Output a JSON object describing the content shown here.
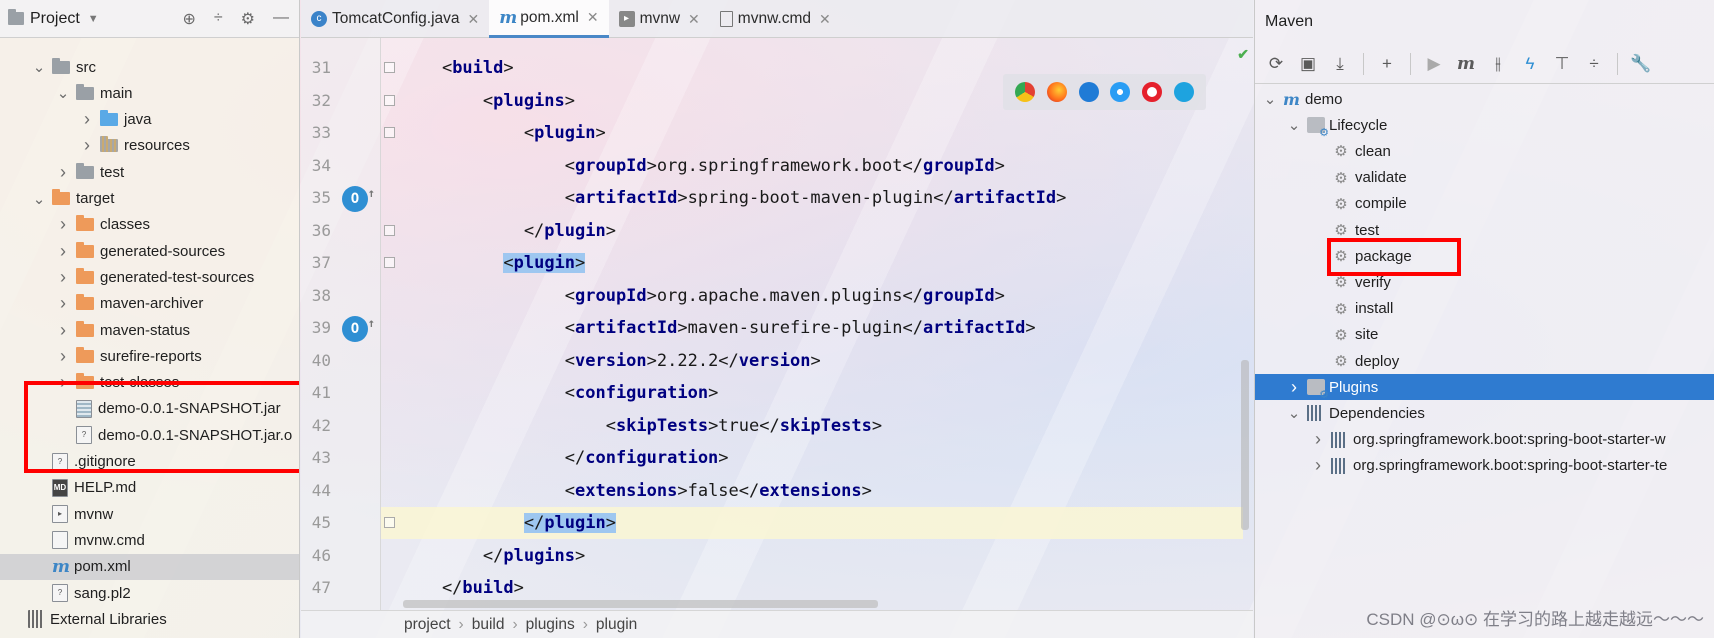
{
  "project": {
    "title": "Project",
    "tree": [
      {
        "label": "src",
        "icon": "folder",
        "expanded": true
      },
      {
        "label": "main",
        "icon": "folder",
        "expanded": true
      },
      {
        "label": "java",
        "icon": "source-folder",
        "expanded": false
      },
      {
        "label": "resources",
        "icon": "resources-folder",
        "expanded": false
      },
      {
        "label": "test",
        "icon": "folder",
        "expanded": false
      },
      {
        "label": "target",
        "icon": "excluded-folder",
        "expanded": true
      },
      {
        "label": "classes",
        "icon": "excluded-folder",
        "expanded": false
      },
      {
        "label": "generated-sources",
        "icon": "excluded-folder",
        "expanded": false
      },
      {
        "label": "generated-test-sources",
        "icon": "excluded-folder",
        "expanded": false
      },
      {
        "label": "maven-archiver",
        "icon": "excluded-folder",
        "expanded": false
      },
      {
        "label": "maven-status",
        "icon": "excluded-folder",
        "expanded": false
      },
      {
        "label": "surefire-reports",
        "icon": "excluded-folder",
        "expanded": false
      },
      {
        "label": "test-classes",
        "icon": "excluded-folder",
        "expanded": false
      },
      {
        "label": "demo-0.0.1-SNAPSHOT.jar",
        "icon": "jar-file"
      },
      {
        "label": "demo-0.0.1-SNAPSHOT.jar.o",
        "icon": "unknown-file"
      },
      {
        "label": ".gitignore",
        "icon": "unknown-file"
      },
      {
        "label": "HELP.md",
        "icon": "markdown-file"
      },
      {
        "label": "mvnw",
        "icon": "script-file"
      },
      {
        "label": "mvnw.cmd",
        "icon": "text-file"
      },
      {
        "label": "pom.xml",
        "icon": "maven-file",
        "selected": true
      },
      {
        "label": "sang.pl2",
        "icon": "unknown-file"
      },
      {
        "label": "External Libraries",
        "icon": "libraries"
      }
    ]
  },
  "editor": {
    "tabs": [
      {
        "label": "TomcatConfig.java",
        "icon": "class-icon",
        "active": false
      },
      {
        "label": "pom.xml",
        "icon": "maven-icon",
        "active": true
      },
      {
        "label": "mvnw",
        "icon": "script-icon",
        "active": false
      },
      {
        "label": "mvnw.cmd",
        "icon": "text-icon",
        "active": false
      }
    ],
    "lines": [
      {
        "n": "31",
        "text": "    <build>"
      },
      {
        "n": "32",
        "text": "        <plugins>"
      },
      {
        "n": "33",
        "text": "            <plugin>"
      },
      {
        "n": "34",
        "text": "                <groupId>org.springframework.boot</groupId>"
      },
      {
        "n": "35",
        "text": "                <artifactId>spring-boot-maven-plugin</artifactId>"
      },
      {
        "n": "36",
        "text": "            </plugin>"
      },
      {
        "n": "37",
        "text": "          <plugin>"
      },
      {
        "n": "38",
        "text": "                <groupId>org.apache.maven.plugins</groupId>"
      },
      {
        "n": "39",
        "text": "                <artifactId>maven-surefire-plugin</artifactId>"
      },
      {
        "n": "40",
        "text": "                <version>2.22.2</version>"
      },
      {
        "n": "41",
        "text": "                <configuration>"
      },
      {
        "n": "42",
        "text": "                    <skipTests>true</skipTests>"
      },
      {
        "n": "43",
        "text": "                </configuration>"
      },
      {
        "n": "44",
        "text": "                <extensions>false</extensions>"
      },
      {
        "n": "45",
        "text": "            </plugin>"
      },
      {
        "n": "46",
        "text": "        </plugins>"
      },
      {
        "n": "47",
        "text": "    </build>"
      }
    ],
    "breadcrumb": [
      "project",
      "build",
      "plugins",
      "plugin"
    ]
  },
  "maven": {
    "title": "Maven",
    "project": "demo",
    "lifecycle_label": "Lifecycle",
    "lifecycle": [
      "clean",
      "validate",
      "compile",
      "test",
      "package",
      "verify",
      "install",
      "site",
      "deploy"
    ],
    "plugins_label": "Plugins",
    "dependencies_label": "Dependencies",
    "dependencies": [
      "org.springframework.boot:spring-boot-starter-w",
      "org.springframework.boot:spring-boot-starter-te"
    ]
  },
  "watermark": "CSDN @⊙ω⊙ 在学习的路上越走越远～～～"
}
